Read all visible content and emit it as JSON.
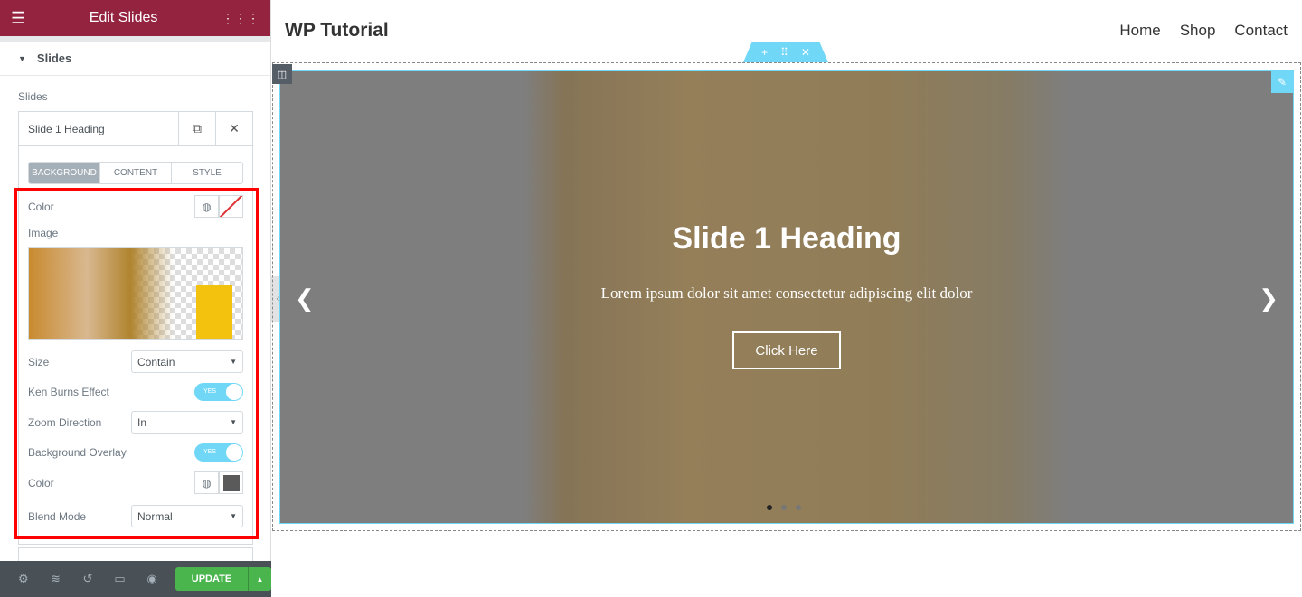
{
  "panel": {
    "title": "Edit Slides",
    "section": "Slides",
    "slides_label": "Slides",
    "slide_item": "Slide 1 Heading",
    "tabs": [
      "BACKGROUND",
      "CONTENT",
      "STYLE"
    ],
    "color_label": "Color",
    "image_label": "Image",
    "size_label": "Size",
    "size_value": "Contain",
    "ken_burns_label": "Ken Burns Effect",
    "ken_burns_toggle": "YES",
    "zoom_label": "Zoom Direction",
    "zoom_value": "In",
    "overlay_label": "Background Overlay",
    "overlay_toggle": "YES",
    "overlay_color_label": "Color",
    "overlay_color": "#5a5a5a",
    "blend_label": "Blend Mode",
    "blend_value": "Normal",
    "update": "UPDATE"
  },
  "site": {
    "brand": "WP Tutorial",
    "nav": [
      "Home",
      "Shop",
      "Contact"
    ],
    "slide": {
      "heading": "Slide 1 Heading",
      "text": "Lorem ipsum dolor sit amet consectetur adipiscing elit dolor",
      "button": "Click Here"
    }
  },
  "colors": {
    "brand": "#93233f",
    "accent": "#71d7f7",
    "update": "#4ab54d"
  }
}
